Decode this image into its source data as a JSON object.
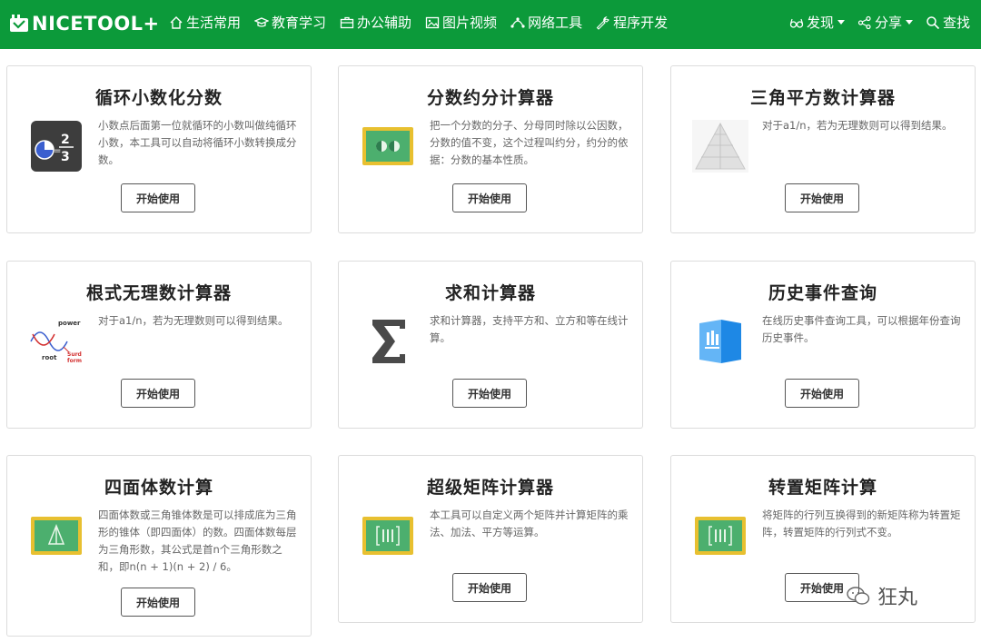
{
  "brand": {
    "logo_text": "NICETOOL+",
    "color": "#0c9a3a"
  },
  "nav": {
    "left": [
      {
        "label": "生活常用",
        "icon": "home-icon"
      },
      {
        "label": "教育学习",
        "icon": "graduation-cap-icon"
      },
      {
        "label": "办公辅助",
        "icon": "briefcase-icon"
      },
      {
        "label": "图片视频",
        "icon": "image-icon"
      },
      {
        "label": "网络工具",
        "icon": "network-icon"
      },
      {
        "label": "程序开发",
        "icon": "wrench-icon"
      }
    ],
    "right": [
      {
        "label": "发现",
        "icon": "glasses-icon",
        "dropdown": true
      },
      {
        "label": "分享",
        "icon": "share-icon",
        "dropdown": true
      },
      {
        "label": "查找",
        "icon": "search-icon",
        "dropdown": false
      }
    ]
  },
  "cards": [
    {
      "title": "循环小数化分数",
      "desc": "小数点后面第一位就循环的小数叫做纯循环小数，本工具可以自动将循环小数转换成分数。",
      "button": "开始使用",
      "icon": "fraction-chart-icon"
    },
    {
      "title": "分数约分计算器",
      "desc": "把一个分数的分子、分母同时除以公因数，分数的值不变，这个过程叫约分，约分的依据：分数的基本性质。",
      "button": "开始使用",
      "icon": "blackboard-icon"
    },
    {
      "title": "三角平方数计算器",
      "desc": "对于a1/n，若为无理数则可以得到结果。",
      "button": "开始使用",
      "icon": "triangle-dots-icon"
    },
    {
      "title": "根式无理数计算器",
      "desc": "对于a1/n，若为无理数则可以得到结果。",
      "button": "开始使用",
      "icon": "surd-diagram-icon"
    },
    {
      "title": "求和计算器",
      "desc": "求和计算器，支持平方和、立方和等在线计算。",
      "button": "开始使用",
      "icon": "sigma-icon"
    },
    {
      "title": "历史事件查询",
      "desc": "在线历史事件查询工具，可以根据年份查询历史事件。",
      "button": "开始使用",
      "icon": "history-book-icon"
    },
    {
      "title": "四面体数计算",
      "desc": "四面体数或三角锥体数是可以排成底为三角形的锥体（即四面体）的数。四面体数每层为三角形数，其公式是首n个三角形数之和，即n(n + 1)(n + 2) / 6。",
      "button": "开始使用",
      "icon": "tetrahedron-board-icon"
    },
    {
      "title": "超级矩阵计算器",
      "desc": "本工具可以自定义两个矩阵并计算矩阵的乘法、加法、平方等运算。",
      "button": "开始使用",
      "icon": "matrix-board-icon"
    },
    {
      "title": "转置矩阵计算",
      "desc": "将矩阵的行列互换得到的新矩阵称为转置矩阵，转置矩阵的行列式不变。",
      "button": "开始使用",
      "icon": "matrix-board-icon"
    }
  ],
  "watermark": {
    "text": "狂丸"
  }
}
